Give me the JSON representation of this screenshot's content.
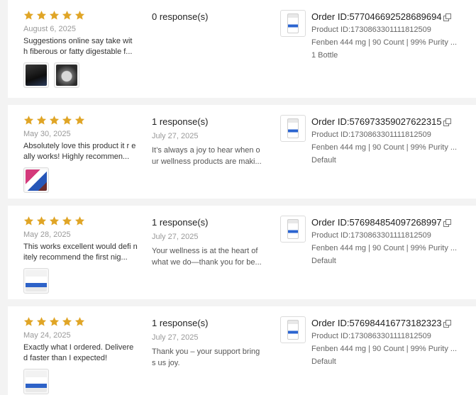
{
  "reviews": [
    {
      "date": "August 6, 2025",
      "text": "Suggestions online say take wit h fiberous or fatty digestable f...",
      "photos": [
        "dark-bottle-photo",
        "dark-capsule-photo"
      ],
      "response_count": "0 response(s)",
      "response_date": "",
      "response_text": "",
      "order_id": "Order ID:577046692528689694",
      "product_id": "Product ID:1730863301111812509",
      "product_name": "Fenben 444 mg | 90 Count | 99% Purity ...",
      "variant": "1 Bottle"
    },
    {
      "date": "May 30, 2025",
      "text": "Absolutely love this product it r eally works! Highly recommen...",
      "photos": [
        "bottle-photo"
      ],
      "response_count": "1 response(s)",
      "response_date": "July 27, 2025",
      "response_text": "It’s always a joy to hear when o ur wellness products are maki...",
      "order_id": "Order ID:576973359027622315",
      "product_id": "Product ID:1730863301111812509",
      "product_name": "Fenben 444 mg | 90 Count | 99% Purity ...",
      "variant": "Default"
    },
    {
      "date": "May 28, 2025",
      "text": "This works excellent would defi nitely recommend the first nig...",
      "photos": [
        "bottle-photo"
      ],
      "response_count": "1 response(s)",
      "response_date": "July 27, 2025",
      "response_text": "Your wellness is at the heart of what we do—thank you for be...",
      "order_id": "Order ID:576984854097268997",
      "product_id": "Product ID:1730863301111812509",
      "product_name": "Fenben 444 mg | 90 Count | 99% Purity ...",
      "variant": "Default"
    },
    {
      "date": "May 24, 2025",
      "text": "Exactly what I ordered. Delivere d faster than I expected!",
      "photos": [
        "bottle-photo"
      ],
      "response_count": "1 response(s)",
      "response_date": "July 27, 2025",
      "response_text": "Thank you – your support bring s us joy.",
      "order_id": "Order ID:576984416773182323",
      "product_id": "Product ID:1730863301111812509",
      "product_name": "Fenben 444 mg | 90 Count | 99% Purity ...",
      "variant": "Default"
    }
  ],
  "rating": 5,
  "colors": {
    "star": "#e0a526",
    "muted": "#999999",
    "card": "#ffffff",
    "bg": "#f3f3f3"
  }
}
